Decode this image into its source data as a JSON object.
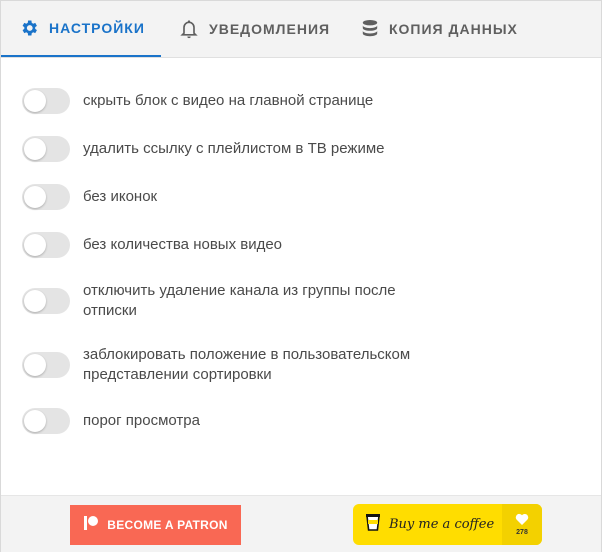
{
  "tabs": [
    {
      "label": "НАСТРОЙКИ",
      "icon": "gear-icon",
      "active": true
    },
    {
      "label": "УВЕДОМЛЕНИЯ",
      "icon": "bell-icon",
      "active": false
    },
    {
      "label": "КОПИЯ ДАННЫХ",
      "icon": "database-icon",
      "active": false
    }
  ],
  "settings": [
    {
      "label": "скрыть блок с видео на главной странице",
      "enabled": false
    },
    {
      "label": "удалить ссылку с плейлистом в ТВ режиме",
      "enabled": false
    },
    {
      "label": "без иконок",
      "enabled": false
    },
    {
      "label": "без количества новых видео",
      "enabled": false
    },
    {
      "label": "отключить удаление канала из группы после отписки",
      "enabled": false
    },
    {
      "label": "заблокировать положение в пользовательском представлении сортировки",
      "enabled": false
    },
    {
      "label": "порог просмотра",
      "enabled": false
    }
  ],
  "footer": {
    "patron_label": "BECOME A PATRON",
    "coffee_label": "Buy me a coffee",
    "coffee_count": "278"
  },
  "colors": {
    "accent": "#1a73c9",
    "patreon": "#f96854",
    "coffee": "#ffdd00"
  }
}
